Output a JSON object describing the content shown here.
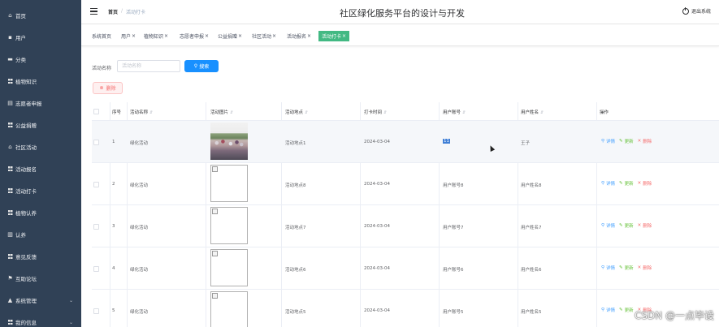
{
  "sidebar": {
    "items": [
      {
        "label": "首页",
        "icon": "home-icon"
      },
      {
        "label": "用户",
        "icon": "user-icon"
      },
      {
        "label": "分类",
        "icon": "category-icon"
      },
      {
        "label": "植物知识",
        "icon": "grid-icon"
      },
      {
        "label": "志愿者申报",
        "icon": "document-icon"
      },
      {
        "label": "公益捐赠",
        "icon": "grid-icon"
      },
      {
        "label": "社区活动",
        "icon": "bank-icon"
      },
      {
        "label": "活动报名",
        "icon": "grid-icon"
      },
      {
        "label": "活动打卡",
        "icon": "grid-icon"
      },
      {
        "label": "植物认养",
        "icon": "grid-icon"
      },
      {
        "label": "认养",
        "icon": "chart-icon"
      },
      {
        "label": "意见反馈",
        "icon": "grid-icon"
      },
      {
        "label": "互助论坛",
        "icon": "flag-icon"
      },
      {
        "label": "系统管理",
        "icon": "settings-icon",
        "has_arrow": true
      },
      {
        "label": "我的信息",
        "icon": "grid-icon",
        "has_arrow": true
      }
    ]
  },
  "header": {
    "breadcrumb_home": "首页",
    "breadcrumb_sep": "/",
    "breadcrumb_current": "活动打卡",
    "title": "社区绿化服务平台的设计与开发",
    "logout_label": "退出系统"
  },
  "tags": [
    {
      "label": "系统首页",
      "closable": false
    },
    {
      "label": "用户",
      "closable": true
    },
    {
      "label": "植物知识",
      "closable": true
    },
    {
      "label": "志愿者申报",
      "closable": true
    },
    {
      "label": "公益捐赠",
      "closable": true
    },
    {
      "label": "社区活动",
      "closable": true
    },
    {
      "label": "活动报名",
      "closable": true
    },
    {
      "label": "活动打卡",
      "closable": true,
      "active": true
    }
  ],
  "close_symbol": "×",
  "search": {
    "label": "活动名称",
    "placeholder": "活动名称",
    "button_label": "搜索"
  },
  "delete_button_label": "删除",
  "table": {
    "columns": [
      "序号",
      "活动名称",
      "活动图片",
      "活动地点",
      "打卡时间",
      "用户账号",
      "用户姓名",
      "操作"
    ],
    "rows": [
      {
        "index": "1",
        "name": "绿化活动",
        "location": "活动地点1",
        "time": "2024-03-04",
        "account": "11",
        "username": "王子",
        "image": "photo"
      },
      {
        "index": "2",
        "name": "绿化活动",
        "location": "活动地点8",
        "time": "2024-03-04",
        "account": "用户账号8",
        "username": "用户姓名8",
        "image": "broken"
      },
      {
        "index": "3",
        "name": "绿化活动",
        "location": "活动地点7",
        "time": "2024-03-04",
        "account": "用户账号7",
        "username": "用户姓名7",
        "image": "broken"
      },
      {
        "index": "4",
        "name": "绿化活动",
        "location": "活动地点6",
        "time": "2024-03-04",
        "account": "用户账号6",
        "username": "用户姓名6",
        "image": "broken"
      },
      {
        "index": "5",
        "name": "绿化活动",
        "location": "活动地点5",
        "time": "2024-03-04",
        "account": "用户账号5",
        "username": "用户姓名5",
        "image": "broken"
      }
    ],
    "actions": {
      "detail": "详情",
      "edit": "更新",
      "delete": "删除"
    }
  },
  "watermark": "CSDN @一点毕设",
  "colors": {
    "sidebar_bg": "#304156",
    "active_tag": "#42b983",
    "primary": "#1890ff",
    "danger": "#f56c6c",
    "success": "#67c23a",
    "link": "#409eff"
  }
}
